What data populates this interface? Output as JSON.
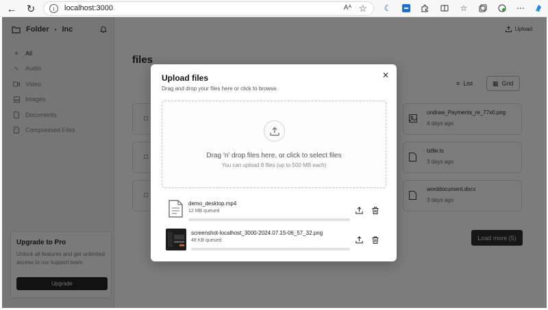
{
  "browser": {
    "url": "localhost:3000",
    "reader_label": "Aᴬ"
  },
  "sidebar": {
    "brand": "Folder",
    "brand_separator": "•",
    "brand_company": "Inc",
    "items": [
      {
        "label": "All",
        "icon": "grid-icon"
      },
      {
        "label": "Audio",
        "icon": "audio-icon"
      },
      {
        "label": "Video",
        "icon": "video-icon"
      },
      {
        "label": "Images",
        "icon": "image-icon"
      },
      {
        "label": "Documents",
        "icon": "document-icon"
      },
      {
        "label": "Compressed Files",
        "icon": "archive-icon"
      }
    ],
    "promo": {
      "title": "Upgrade to Pro",
      "body": "Unlock all features and get unlimited access to our support team.",
      "button": "Upgrade"
    }
  },
  "main": {
    "upload_label": "Upload",
    "title": "files",
    "view_list": "List",
    "view_grid": "Grid",
    "files": [
      {
        "name": "undraw_Payments_re_77x0.png",
        "date": "4 days ago"
      },
      {
        "name": "tsfile.ts",
        "date": "3 days ago"
      },
      {
        "name": "worddocument.docx",
        "date": "3 days ago"
      }
    ],
    "load_more": "Load more (5)"
  },
  "modal": {
    "title": "Upload files",
    "subtitle": "Drag and drop your files here or click to browse.",
    "drop_text": "Drag 'n' drop files here, or click to select files",
    "drop_subtext": "You can upload 8 files (up to 500 MB each)",
    "queue": [
      {
        "name": "demo_desktop.mp4",
        "status": "12 MB queued",
        "progress": 0
      },
      {
        "name": "screenshot-localhost_3000-2024.07.15-06_57_32.png",
        "status": "48 KB queued",
        "progress": 0
      }
    ]
  }
}
